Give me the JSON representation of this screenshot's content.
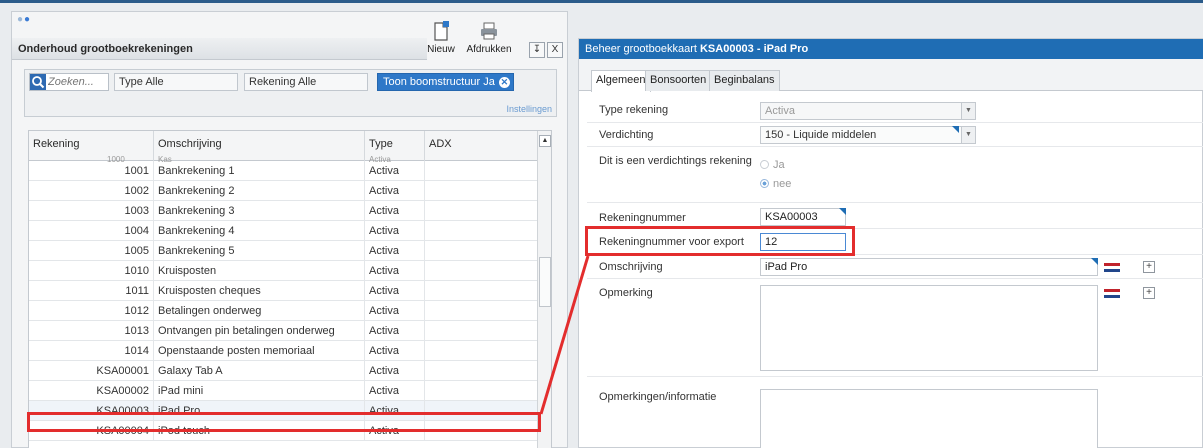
{
  "left_panel": {
    "title": "Onderhoud grootboekrekeningen",
    "toolbar": {
      "new_label": "Nieuw",
      "print_label": "Afdrukken"
    },
    "controls": {
      "pin": "↧",
      "close": "X"
    },
    "filters": {
      "search_placeholder": "Zoeken...",
      "type_label": "Type",
      "type_value": "Alle",
      "account_label": "Rekening",
      "account_value": "Alle",
      "tree_label": "Toon boomstructuur",
      "tree_value": "Ja",
      "settings_link": "Instellingen"
    },
    "grid": {
      "columns": [
        "Rekening",
        "Omschrijving",
        "Type",
        "ADX"
      ],
      "ghost_row": {
        "account": "1000",
        "description": "Kas",
        "type": "Activa"
      },
      "rows": [
        {
          "account": "1001",
          "description": "Bankrekening 1",
          "type": "Activa"
        },
        {
          "account": "1002",
          "description": "Bankrekening 2",
          "type": "Activa"
        },
        {
          "account": "1003",
          "description": "Bankrekening 3",
          "type": "Activa"
        },
        {
          "account": "1004",
          "description": "Bankrekening 4",
          "type": "Activa"
        },
        {
          "account": "1005",
          "description": "Bankrekening 5",
          "type": "Activa"
        },
        {
          "account": "1010",
          "description": "Kruisposten",
          "type": "Activa"
        },
        {
          "account": "1011",
          "description": "Kruisposten cheques",
          "type": "Activa"
        },
        {
          "account": "1012",
          "description": "Betalingen onderweg",
          "type": "Activa"
        },
        {
          "account": "1013",
          "description": "Ontvangen pin betalingen onderweg",
          "type": "Activa"
        },
        {
          "account": "1014",
          "description": "Openstaande posten memoriaal",
          "type": "Activa"
        },
        {
          "account": "KSA00001",
          "description": "Galaxy Tab A",
          "type": "Activa"
        },
        {
          "account": "KSA00002",
          "description": "iPad mini",
          "type": "Activa"
        },
        {
          "account": "KSA00003",
          "description": "iPad Pro",
          "type": "Activa"
        },
        {
          "account": "KSA00004",
          "description": "iPod touch",
          "type": "Activa"
        }
      ]
    }
  },
  "right_panel": {
    "header_prefix": "Beheer grootboekkaart",
    "header_title": "KSA00003 - iPad Pro",
    "tabs": [
      "Algemeen",
      "Bonsoorten",
      "Beginbalans"
    ],
    "fields": {
      "type_label": "Type rekening",
      "type_value": "Activa",
      "compression_label": "Verdichting",
      "compression_value": "150 - Liquide middelen",
      "is_compression_label": "Dit is een verdichtings rekening",
      "radio_yes": "Ja",
      "radio_no": "nee",
      "account_number_label": "Rekeningnummer",
      "account_number_value": "KSA00003",
      "export_number_label": "Rekeningnummer voor export",
      "export_number_value": "12",
      "description_label": "Omschrijving",
      "description_value": "iPad Pro",
      "remark_label": "Opmerking",
      "remarks_info_label": "Opmerkingen/informatie"
    }
  },
  "colors": {
    "accent": "#1f6db4",
    "highlight": "#e32d2d"
  }
}
